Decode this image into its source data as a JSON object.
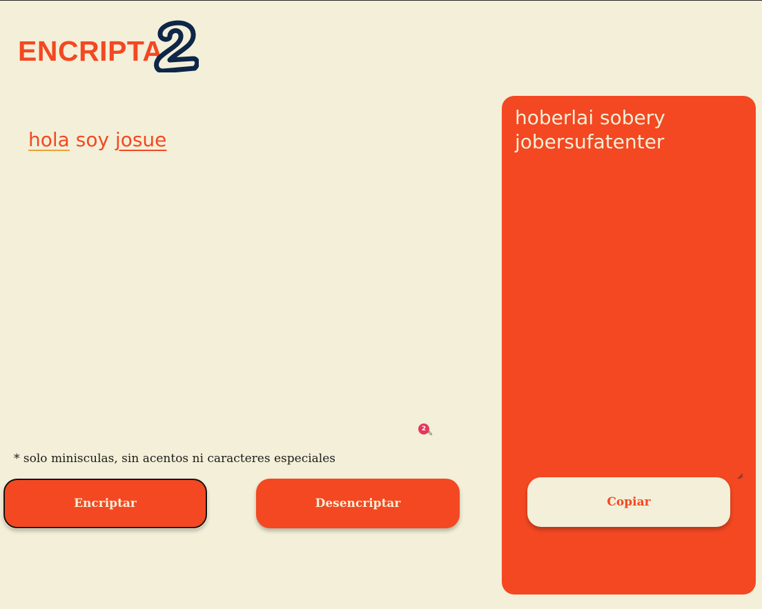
{
  "header": {
    "logo_text": "ENCRIPTA",
    "logo_number": "2"
  },
  "input": {
    "words": [
      "hola",
      "soy",
      "josue"
    ]
  },
  "grammar_badge": {
    "count": "2"
  },
  "note": "* solo miniscul​as, sin acentos ni caracteres especiales",
  "buttons": {
    "encrypt_label": "Encriptar",
    "decrypt_label": "Desencriptar"
  },
  "output": {
    "text": "hoberlai sobery jobersufatenter",
    "copy_label": "Copiar"
  },
  "colors": {
    "background": "#f3efd8",
    "accent": "#f34822",
    "logo_dark": "#0e2647"
  }
}
